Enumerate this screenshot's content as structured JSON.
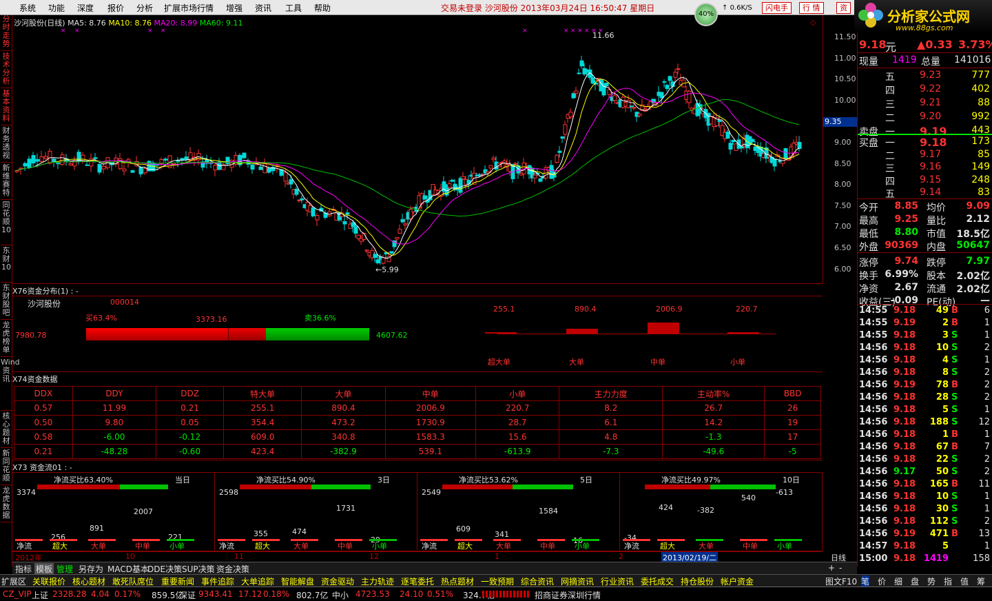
{
  "menu": [
    "系统",
    "功能",
    "深度",
    "报价",
    "分析",
    "扩展市场行情",
    "增强",
    "资讯",
    "工具",
    "帮助"
  ],
  "title_center": "交易未登录   沙河股份  2013年03月24日  16:50:47  星期日",
  "badge": {
    "percent": "40%",
    "up": "0.6K/S",
    "down": "0.2K/S"
  },
  "pills": [
    "闪电手",
    "行 情",
    "资"
  ],
  "logo": {
    "text": "分析家公式网",
    "url": "www.88gs.com"
  },
  "sidebar": [
    "分时走势",
    "技术分析",
    "基本资料",
    "财务透视",
    "新维赛特",
    "同花顺10",
    "东财10",
    "东财股吧",
    "龙虎榜单",
    "Wind资讯",
    "核心题材",
    "新同花顺",
    "龙虎数据"
  ],
  "kline": {
    "title": "沙河股份(日线)",
    "ma5": "MA5: 8.76",
    "ma10": "MA10: 8.76",
    "ma20": "MA20: 8.99",
    "ma60": "MA60: 9.11",
    "high_label": "11.66",
    "low_label": "5.99",
    "axis": [
      "11.50",
      "11.00",
      "10.50",
      "10.00",
      "9.50",
      "9.00",
      "8.50",
      "8.00",
      "7.50",
      "7.00",
      "6.50",
      "6.00"
    ],
    "cur_label": "9.35"
  },
  "dist": {
    "title": "X76资金分布(1) : -",
    "name": "沙河股份",
    "code": "000014",
    "buy": "买63.4%",
    "sell": "卖36.6%",
    "mid": "3373.16",
    "left": "7980.78",
    "right": "4607.62",
    "cats": [
      {
        "v": "255.1",
        "n": "超大单"
      },
      {
        "v": "890.4",
        "n": "大单"
      },
      {
        "v": "2006.9",
        "n": "中单"
      },
      {
        "v": "220.7",
        "n": "小单"
      }
    ]
  },
  "data_table": {
    "title": "X74资金数据",
    "headers": [
      "DDX",
      "DDY",
      "DDZ",
      "特大单",
      "大单",
      "中单",
      "小单",
      "主力力度",
      "主动率%",
      "BBD"
    ],
    "rows": [
      [
        "0.57",
        "11.99",
        "0.21",
        "255.1",
        "890.4",
        "2006.9",
        "220.7",
        "8.2",
        "26.7",
        "26"
      ],
      [
        "0.50",
        "9.80",
        "0.05",
        "354.4",
        "473.2",
        "1730.9",
        "28.7",
        "6.1",
        "14.2",
        "19"
      ],
      [
        "0.58",
        "-6.00",
        "-0.12",
        "609.0",
        "340.8",
        "1583.3",
        "15.6",
        "4.8",
        "-1.3",
        "17"
      ],
      [
        "0.21",
        "-48.28",
        "-0.60",
        "423.4",
        "-382.9",
        "539.1",
        "-613.9",
        "-7.3",
        "-49.6",
        "-5"
      ]
    ]
  },
  "flow": {
    "title": "X73 资金流01 : -",
    "panels": [
      {
        "ratio": "净流买比63.40%",
        "period": "当日",
        "vals": [
          "3374",
          "256",
          "891",
          "2007",
          "221"
        ]
      },
      {
        "ratio": "净流买比54.90%",
        "period": "3日",
        "vals": [
          "2598",
          "355",
          "474",
          "1731",
          "29"
        ]
      },
      {
        "ratio": "净流买比53.62%",
        "period": "5日",
        "vals": [
          "2549",
          "609",
          "341",
          "1584",
          "16"
        ]
      },
      {
        "ratio": "净流买比49.97%",
        "period": "10日",
        "vals": [
          "-34",
          "424",
          "-382",
          "540",
          "-613"
        ]
      }
    ],
    "labels": [
      "净流",
      "超大",
      "大单",
      "中单",
      "小单"
    ]
  },
  "dates": [
    "2012年",
    "10",
    "11",
    "12",
    "1",
    "2",
    "2013/02/19/二"
  ],
  "period_label": "日线",
  "tabs1": [
    "指标",
    "模板",
    "管理",
    "另存为",
    "MACD基本",
    "DDE决策",
    "SUP决策",
    "资金决策"
  ],
  "tabs2": [
    "扩展区",
    "关联报价",
    "核心题材",
    "敢死队席位",
    "重要新闻",
    "事件追踪",
    "大单追踪",
    "智能解盘",
    "资金驱动",
    "主力轨迹",
    "逐笔委托",
    "热点题材",
    "一致预期",
    "综合资讯",
    "网摘资讯",
    "行业资讯",
    "委托成交",
    "持仓股份",
    "帐户资金"
  ],
  "right_tabs": [
    "图文F10",
    "笔",
    "价",
    "细",
    "盘",
    "势",
    "指",
    "值",
    "筹"
  ],
  "quote": {
    "price": "9.18",
    "unit": "元",
    "change": "▲0.33",
    "pct": "3.73%",
    "xianliang_label": "现量",
    "xianliang": "1419",
    "zongliang_label": "总量",
    "zongliang": "141016",
    "sell": [
      [
        "五",
        "9.23",
        "777"
      ],
      [
        "四",
        "9.22",
        "402"
      ],
      [
        "三",
        "9.21",
        "88"
      ],
      [
        "二",
        "9.20",
        "992"
      ],
      [
        "一",
        "9.19",
        "443"
      ]
    ],
    "sell_label": "卖盘",
    "buy_label": "买盘",
    "buy": [
      [
        "一",
        "9.18",
        "173"
      ],
      [
        "二",
        "9.17",
        "85"
      ],
      [
        "三",
        "9.16",
        "149"
      ],
      [
        "四",
        "9.15",
        "248"
      ],
      [
        "五",
        "9.14",
        "83"
      ]
    ],
    "stats": [
      [
        "今开",
        "8.85",
        "均价",
        "9.09"
      ],
      [
        "最高",
        "9.25",
        "量比",
        "2.12"
      ],
      [
        "最低",
        "8.80",
        "市值",
        "18.5亿"
      ],
      [
        "外盘",
        "90369",
        "内盘",
        "50647"
      ],
      [
        "涨停",
        "9.74",
        "跌停",
        "7.97"
      ],
      [
        "换手",
        "6.99%",
        "股本",
        "2.02亿"
      ],
      [
        "净资",
        "2.67",
        "流通",
        "2.02亿"
      ],
      [
        "收益(三)",
        "-0.09",
        "PE(动)",
        "—"
      ]
    ]
  },
  "ticks": [
    [
      "14:55",
      "9.18",
      "49",
      "B",
      "6"
    ],
    [
      "14:55",
      "9.19",
      "2",
      "B",
      "1"
    ],
    [
      "14:55",
      "9.18",
      "3",
      "S",
      "1"
    ],
    [
      "14:56",
      "9.18",
      "10",
      "S",
      "2"
    ],
    [
      "14:56",
      "9.18",
      "4",
      "S",
      "1"
    ],
    [
      "14:56",
      "9.18",
      "8",
      "S",
      "2"
    ],
    [
      "14:56",
      "9.19",
      "78",
      "B",
      "2"
    ],
    [
      "14:56",
      "9.18",
      "28",
      "S",
      "2"
    ],
    [
      "14:56",
      "9.18",
      "5",
      "S",
      "1"
    ],
    [
      "14:56",
      "9.18",
      "188",
      "S",
      "12"
    ],
    [
      "14:56",
      "9.18",
      "1",
      "B",
      "1"
    ],
    [
      "14:56",
      "9.18",
      "67",
      "B",
      "7"
    ],
    [
      "14:56",
      "9.18",
      "22",
      "S",
      "2"
    ],
    [
      "14:56",
      "9.17",
      "50",
      "S",
      "2"
    ],
    [
      "14:56",
      "9.18",
      "165",
      "B",
      "11"
    ],
    [
      "14:56",
      "9.18",
      "10",
      "S",
      "1"
    ],
    [
      "14:56",
      "9.18",
      "30",
      "S",
      "1"
    ],
    [
      "14:56",
      "9.18",
      "112",
      "S",
      "2"
    ],
    [
      "14:56",
      "9.19",
      "471",
      "B",
      "13"
    ],
    [
      "14:57",
      "9.18",
      "5",
      "",
      "1"
    ],
    [
      "15:00",
      "9.18",
      "1419",
      "",
      "158"
    ]
  ],
  "status": [
    {
      "t": "CZ_VIP",
      "c": "#ff3232"
    },
    {
      "t": "上证",
      "c": "#e0e0e0"
    },
    {
      "t": "2328.28",
      "c": "#ff3232"
    },
    {
      "t": "4.04",
      "c": "#ff3232"
    },
    {
      "t": "0.17%",
      "c": "#ff3232"
    },
    {
      "t": "859.5亿",
      "c": "#e0e0e0"
    },
    {
      "t": "深证",
      "c": "#e0e0e0"
    },
    {
      "t": "9343.41",
      "c": "#ff3232"
    },
    {
      "t": "17.12",
      "c": "#ff3232"
    },
    {
      "t": "0.18%",
      "c": "#ff3232"
    },
    {
      "t": "802.7亿",
      "c": "#e0e0e0"
    },
    {
      "t": "中小",
      "c": "#e0e0e0"
    },
    {
      "t": "4723.53",
      "c": "#ff3232"
    },
    {
      "t": "24.10",
      "c": "#ff3232"
    },
    {
      "t": "0.51%",
      "c": "#ff3232"
    },
    {
      "t": "324.7亿",
      "c": "#e0e0e0"
    },
    {
      "t": "招商证券深圳行情",
      "c": "#e0e0e0"
    }
  ]
}
